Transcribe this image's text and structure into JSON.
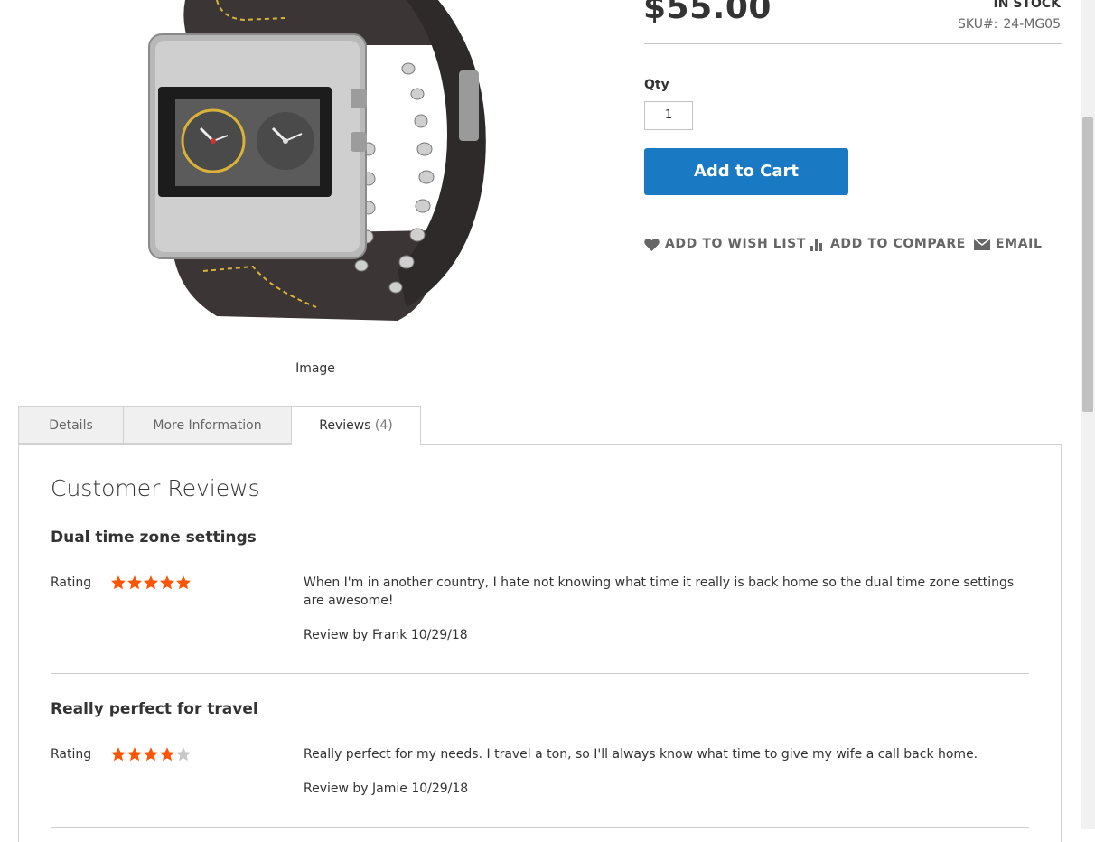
{
  "product": {
    "price": "$55.00",
    "stock_status": "IN STOCK",
    "sku_label": "SKU#:",
    "sku_value": "24-MG05",
    "image_caption": "Image"
  },
  "purchase": {
    "qty_label": "Qty",
    "qty_value": "1",
    "add_to_cart_label": "Add to Cart"
  },
  "actions": {
    "wishlist": "ADD TO WISH LIST",
    "compare": "ADD TO COMPARE",
    "email": "EMAIL"
  },
  "tabs": [
    {
      "label": "Details"
    },
    {
      "label": "More Information"
    },
    {
      "label": "Reviews",
      "count": "(4)",
      "active": true
    }
  ],
  "reviews": {
    "section_title": "Customer Reviews",
    "rating_label": "Rating",
    "items": [
      {
        "title": "Dual time zone settings",
        "rating": 5,
        "max_rating": 5,
        "text": "When I'm in another country, I hate not knowing what time it really is back home so the dual time zone settings are awesome!",
        "byline": "Review by Frank 10/29/18"
      },
      {
        "title": "Really perfect for travel",
        "rating": 4,
        "max_rating": 5,
        "text": "Really perfect for my needs. I travel a ton, so I'll always know what time to give my wife a call back home.",
        "byline": "Review by Jamie 10/29/18"
      }
    ]
  },
  "colors": {
    "primary_button": "#1979c3",
    "star_filled": "#ff5501",
    "star_empty": "#c7c7c7"
  }
}
